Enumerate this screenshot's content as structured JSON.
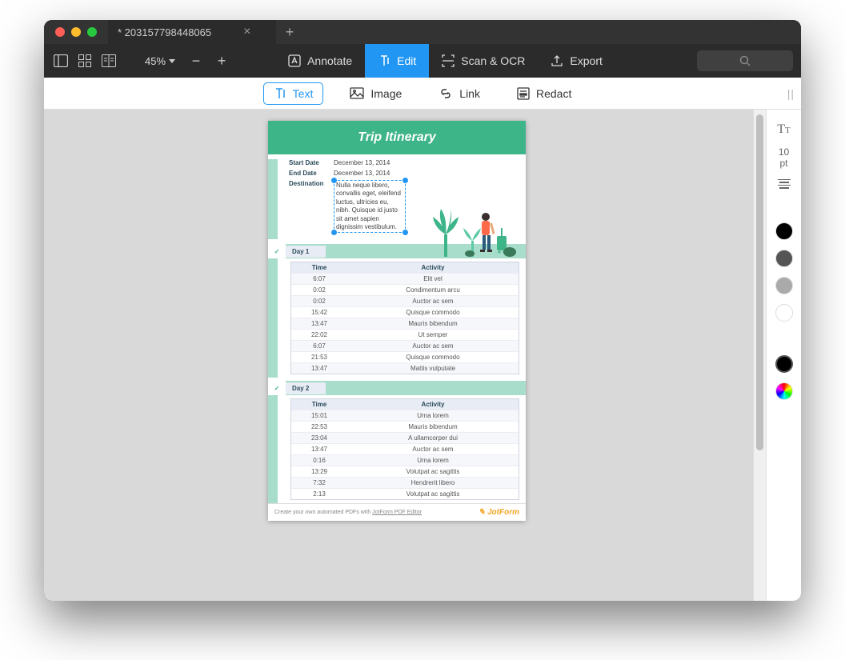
{
  "window": {
    "tab_title": "* 203157798448065"
  },
  "toolbar": {
    "zoom": "45%",
    "annotate": "Annotate",
    "edit": "Edit",
    "scan_ocr": "Scan & OCR",
    "export": "Export"
  },
  "subtoolbar": {
    "text": "Text",
    "image": "Image",
    "link": "Link",
    "redact": "Redact"
  },
  "right_panel": {
    "font_size_value": "10",
    "font_size_unit": "pt",
    "swatches": [
      "#000000",
      "#555555",
      "#aaaaaa",
      "#ffffff"
    ],
    "current_swatch": "#000000"
  },
  "document": {
    "title": "Trip Itinerary",
    "fields": {
      "start_date_label": "Start Date",
      "start_date_value": "December 13, 2014",
      "end_date_label": "End Date",
      "end_date_value": "December 13, 2014",
      "destination_label": "Destination",
      "destination_value": "Nulla neque libero, convallis eget, eleifend luctus, ultricies eu, nibh. Quisque id justo sit amet sapien dignissim vestibulum."
    },
    "days": [
      {
        "label": "Day 1",
        "headers": {
          "time": "Time",
          "activity": "Activity"
        },
        "rows": [
          {
            "time": "6:07",
            "activity": "Elit vel"
          },
          {
            "time": "0:02",
            "activity": "Condimentum arcu"
          },
          {
            "time": "0:02",
            "activity": "Auctor ac sem"
          },
          {
            "time": "15:42",
            "activity": "Quisque commodo"
          },
          {
            "time": "13:47",
            "activity": "Mauris bibendum"
          },
          {
            "time": "22:02",
            "activity": "Ut semper"
          },
          {
            "time": "6:07",
            "activity": "Auctor ac sem"
          },
          {
            "time": "21:53",
            "activity": "Quisque commodo"
          },
          {
            "time": "13:47",
            "activity": "Mattis vulputate"
          }
        ]
      },
      {
        "label": "Day 2",
        "headers": {
          "time": "Time",
          "activity": "Activity"
        },
        "rows": [
          {
            "time": "15:01",
            "activity": "Urna lorem"
          },
          {
            "time": "22:53",
            "activity": "Mauris bibendum"
          },
          {
            "time": "23:04",
            "activity": "A ullamcorper dui"
          },
          {
            "time": "13:47",
            "activity": "Auctor ac sem"
          },
          {
            "time": "0:16",
            "activity": "Urna lorem"
          },
          {
            "time": "13:29",
            "activity": "Volutpat ac sagittis"
          },
          {
            "time": "7:32",
            "activity": "Hendrerit libero"
          },
          {
            "time": "2:13",
            "activity": "Volutpat ac sagittis"
          }
        ]
      }
    ],
    "footer": {
      "text": "Create your own automated PDFs with ",
      "link": "JotForm PDF Editor",
      "brand": "JotForm"
    }
  }
}
